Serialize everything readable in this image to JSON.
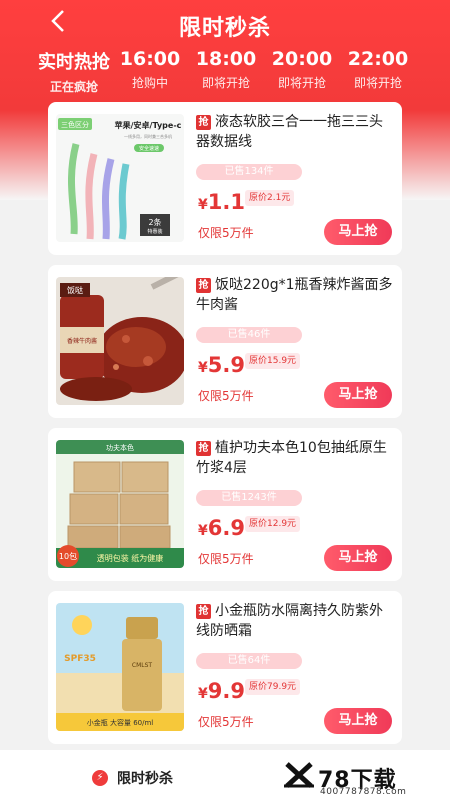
{
  "nav": {
    "back_icon": "back-chevron-icon",
    "title": "限时秒杀"
  },
  "tabs": [
    {
      "time": "实时热抢",
      "status": "正在疯抢",
      "active": true
    },
    {
      "time": "16:00",
      "status": "抢购中"
    },
    {
      "time": "18:00",
      "status": "即将开抢"
    },
    {
      "time": "20:00",
      "status": "即将开抢"
    },
    {
      "time": "22:00",
      "status": "即将开抢"
    }
  ],
  "products": [
    {
      "tag": "抢",
      "name": "液态软胶三合一一拖三三头器数据线",
      "sold": "已售134件",
      "currency": "¥",
      "price": "1.1",
      "original": "原价2.1元",
      "limit": "仅限5万件",
      "buy": "马上抢",
      "image": {
        "corner": "三色区分",
        "headline": "苹果/安卓/Type-c",
        "sub": "一线多用，同时兼三合多机",
        "badge": "安全速速",
        "count": "2条",
        "count_sub": "特惠装"
      }
    },
    {
      "tag": "抢",
      "name": "饭哒220g*1瓶香辣炸酱面多牛肉酱",
      "sold": "已售46件",
      "currency": "¥",
      "price": "5.9",
      "original": "原价15.9元",
      "limit": "仅限5万件",
      "buy": "马上抢",
      "image": {
        "brand": "饭哒",
        "label": "香辣牛肉酱"
      }
    },
    {
      "tag": "抢",
      "name": "植护功夫本色10包抽纸原生竹浆4层",
      "sold": "已售1243件",
      "currency": "¥",
      "price": "6.9",
      "original": "原价12.9元",
      "limit": "仅限5万件",
      "buy": "马上抢",
      "image": {
        "top": "功夫本色",
        "count": "10包",
        "banner": "透明包装 纸为健康"
      }
    },
    {
      "tag": "抢",
      "name": "小金瓶防水隔离持久防紫外线防晒霜",
      "sold": "已售64件",
      "currency": "¥",
      "price": "9.9",
      "original": "原价79.9元",
      "limit": "仅限5万件",
      "buy": "马上抢",
      "image": {
        "spf": "SPF35",
        "bottle": "CMLST",
        "caption": "小金瓶 大容量 60/ml"
      }
    }
  ],
  "bottom_bar": {
    "icon": "lightning-icon",
    "label": "限时秒杀"
  },
  "watermark": {
    "text": "78下载",
    "url": "4007787878.com"
  },
  "colors": {
    "primary": "#ef3b3b",
    "accent": "#e33636",
    "sold_bar": "#fdd1d4"
  }
}
